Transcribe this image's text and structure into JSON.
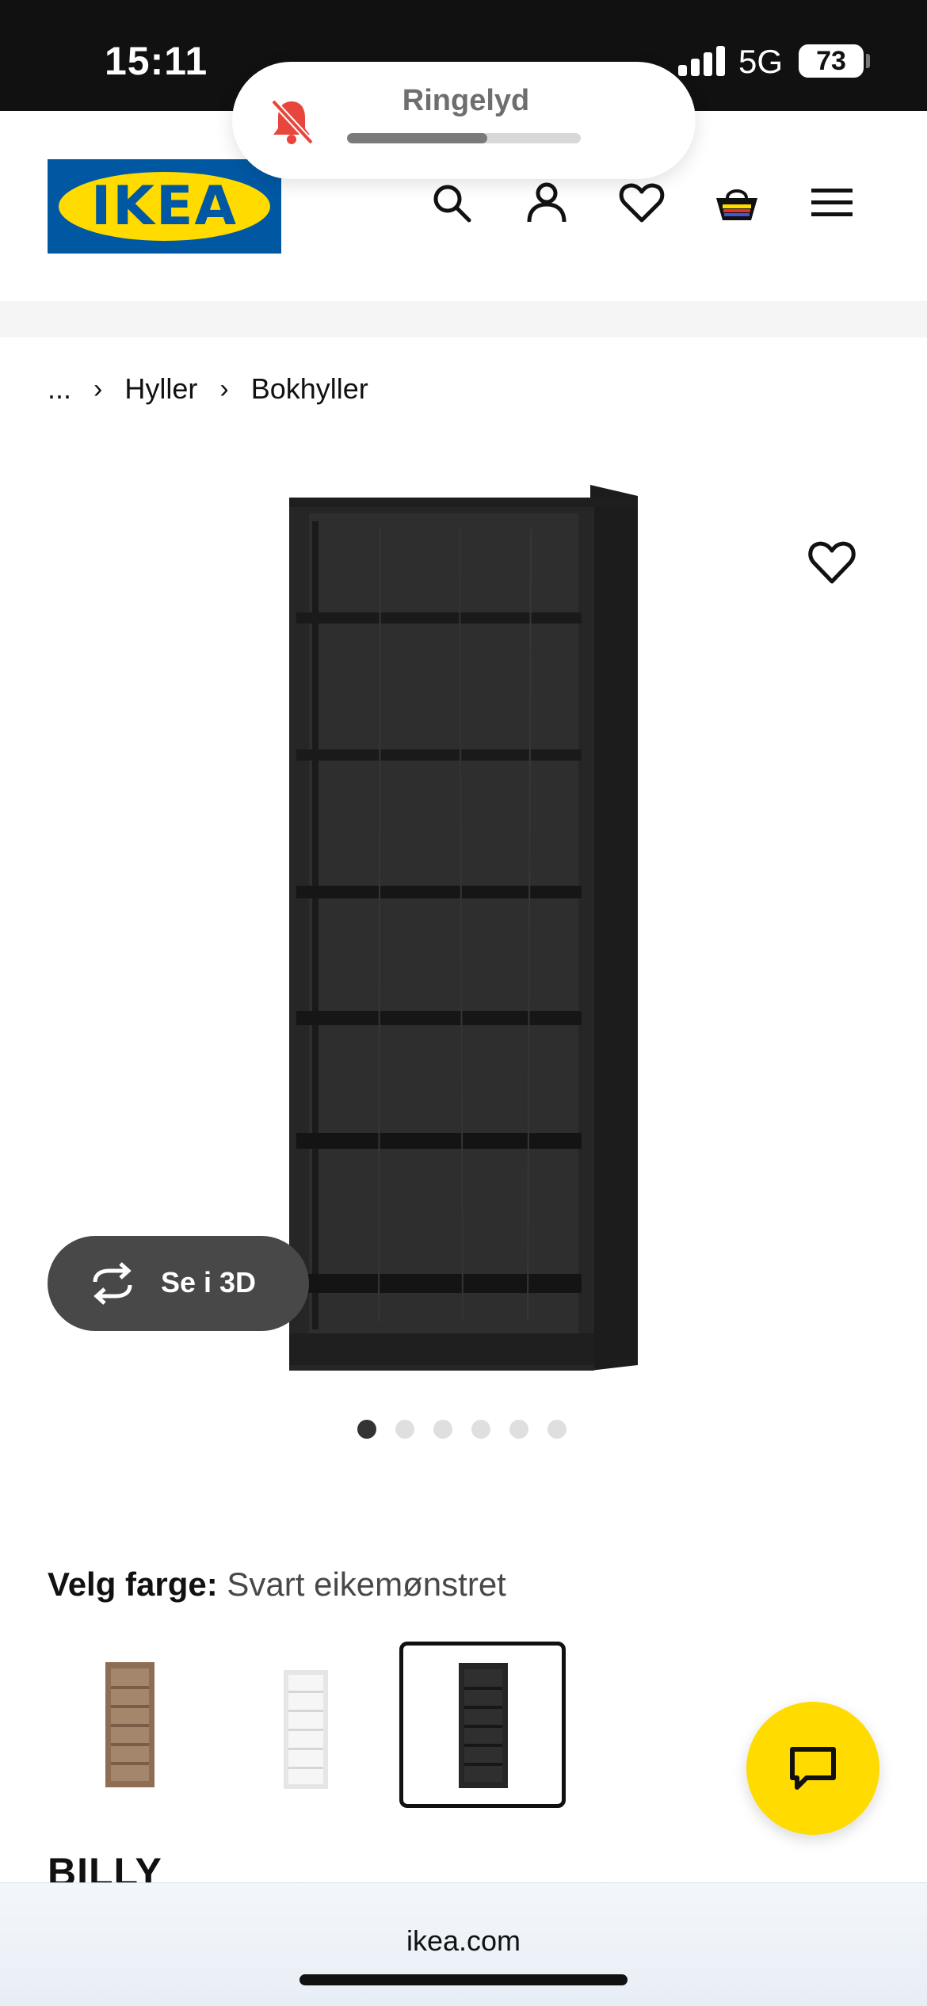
{
  "status_bar": {
    "time": "15:11",
    "network": "5G",
    "battery": "73"
  },
  "ringer": {
    "label": "Ringelyd",
    "level": 0.6,
    "icon": "bell-muted-icon"
  },
  "header": {
    "logo_text": "IKEA",
    "icons": [
      "search-icon",
      "user-icon",
      "heart-icon",
      "cart-icon",
      "menu-icon"
    ]
  },
  "breadcrumb": {
    "ellipsis": "...",
    "items": [
      "Hyller",
      "Bokhyller"
    ]
  },
  "gallery": {
    "view_3d_label": "Se i 3D",
    "total_images": 6,
    "active_index": 0
  },
  "color_picker": {
    "label": "Velg farge:",
    "selected_value": "Svart eikemønstret",
    "swatches": [
      {
        "name": "brown-oak",
        "color": "#8d6e55"
      },
      {
        "name": "white",
        "color": "#f2f2f2"
      },
      {
        "name": "black-oak",
        "color": "#2a2a2a",
        "selected": true
      }
    ]
  },
  "product": {
    "name": "BILLY"
  },
  "browser": {
    "url": "ikea.com"
  },
  "colors": {
    "ikea_blue": "#0058a3",
    "ikea_yellow": "#ffdb00"
  }
}
